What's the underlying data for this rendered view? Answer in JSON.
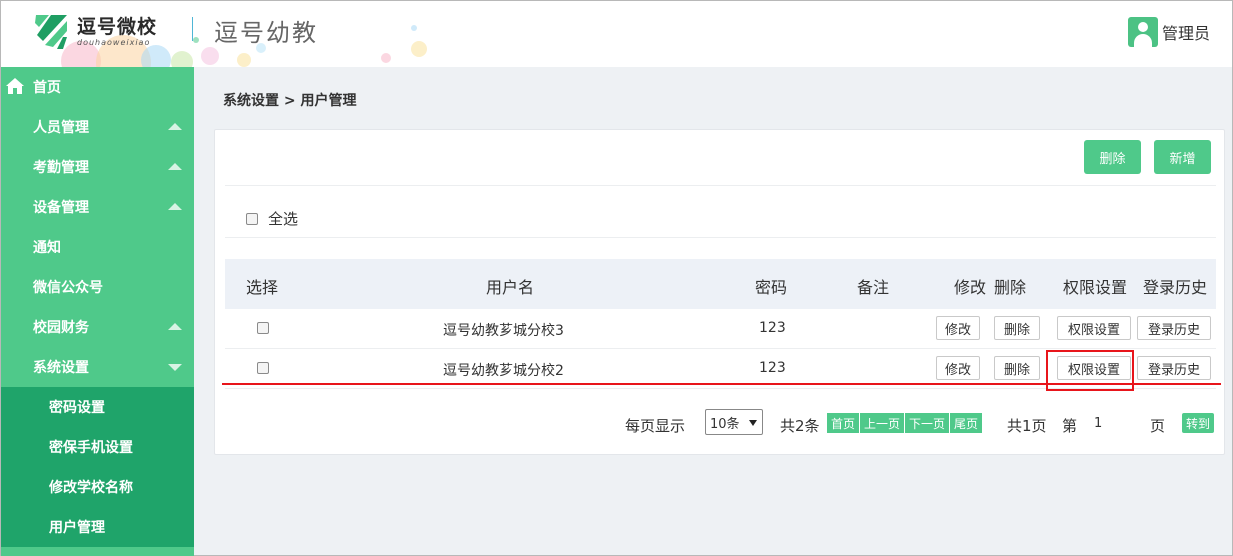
{
  "header": {
    "logo_name": "逗号微校",
    "logo_sub": "douhaoweixiao",
    "title": "逗号幼教",
    "user_label": "管理员"
  },
  "sidebar": {
    "home": "首页",
    "items": [
      {
        "label": "人员管理",
        "expanded": false
      },
      {
        "label": "考勤管理",
        "expanded": false
      },
      {
        "label": "设备管理",
        "expanded": false
      },
      {
        "label": "通知"
      },
      {
        "label": "微信公众号"
      },
      {
        "label": "校园财务",
        "expanded": false
      },
      {
        "label": "系统设置",
        "expanded": true
      }
    ],
    "subitems": [
      {
        "label": "密码设置"
      },
      {
        "label": "密保手机设置"
      },
      {
        "label": "修改学校名称"
      },
      {
        "label": "用户管理"
      }
    ]
  },
  "breadcrumb": "系统设置 > 用户管理",
  "toolbar": {
    "delete_label": "删除",
    "add_label": "新增"
  },
  "select_all_label": "全选",
  "table": {
    "headers": {
      "select": "选择",
      "username": "用户名",
      "password": "密码",
      "remark": "备注",
      "edit": "修改",
      "delete": "删除",
      "permissions": "权限设置",
      "history": "登录历史"
    },
    "rows": [
      {
        "username": "逗号幼教芗城分校3",
        "password": "123",
        "remark": "",
        "edit": "修改",
        "delete": "删除",
        "permissions": "权限设置",
        "history": "登录历史"
      },
      {
        "username": "逗号幼教芗城分校2",
        "password": "123",
        "remark": "",
        "edit": "修改",
        "delete": "删除",
        "permissions": "权限设置",
        "history": "登录历史"
      }
    ]
  },
  "pagination": {
    "per_page_label": "每页显示",
    "per_page_value": "10条",
    "total_items": "共2条",
    "first": "首页",
    "prev": "上一页",
    "next": "下一页",
    "last": "尾页",
    "total_pages": "共1页",
    "page_prefix": "第",
    "current_page": "1",
    "page_suffix": "页",
    "goto": "转到"
  },
  "colors": {
    "brand_green": "#4fc98a",
    "sidebar_active": "#1fa46a",
    "annotation_red": "#e8151b"
  }
}
